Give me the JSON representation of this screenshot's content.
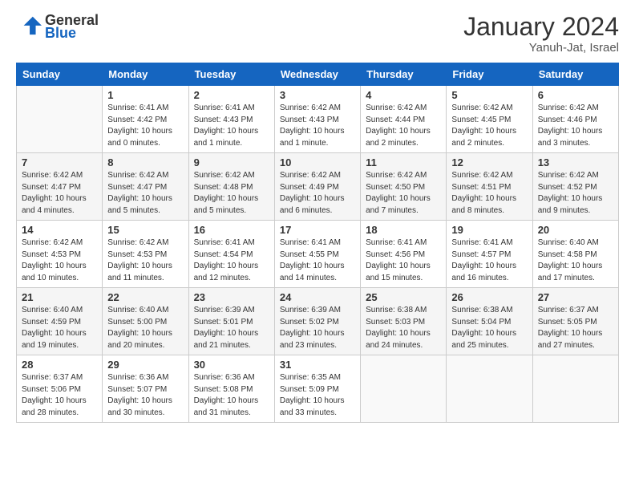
{
  "header": {
    "logo_general": "General",
    "logo_blue": "Blue",
    "month_year": "January 2024",
    "location": "Yanuh-Jat, Israel"
  },
  "calendar": {
    "days_of_week": [
      "Sunday",
      "Monday",
      "Tuesday",
      "Wednesday",
      "Thursday",
      "Friday",
      "Saturday"
    ],
    "weeks": [
      [
        {
          "day": "",
          "sunrise": "",
          "sunset": "",
          "daylight": ""
        },
        {
          "day": "1",
          "sunrise": "Sunrise: 6:41 AM",
          "sunset": "Sunset: 4:42 PM",
          "daylight": "Daylight: 10 hours and 0 minutes."
        },
        {
          "day": "2",
          "sunrise": "Sunrise: 6:41 AM",
          "sunset": "Sunset: 4:43 PM",
          "daylight": "Daylight: 10 hours and 1 minute."
        },
        {
          "day": "3",
          "sunrise": "Sunrise: 6:42 AM",
          "sunset": "Sunset: 4:43 PM",
          "daylight": "Daylight: 10 hours and 1 minute."
        },
        {
          "day": "4",
          "sunrise": "Sunrise: 6:42 AM",
          "sunset": "Sunset: 4:44 PM",
          "daylight": "Daylight: 10 hours and 2 minutes."
        },
        {
          "day": "5",
          "sunrise": "Sunrise: 6:42 AM",
          "sunset": "Sunset: 4:45 PM",
          "daylight": "Daylight: 10 hours and 2 minutes."
        },
        {
          "day": "6",
          "sunrise": "Sunrise: 6:42 AM",
          "sunset": "Sunset: 4:46 PM",
          "daylight": "Daylight: 10 hours and 3 minutes."
        }
      ],
      [
        {
          "day": "7",
          "sunrise": "Sunrise: 6:42 AM",
          "sunset": "Sunset: 4:47 PM",
          "daylight": "Daylight: 10 hours and 4 minutes."
        },
        {
          "day": "8",
          "sunrise": "Sunrise: 6:42 AM",
          "sunset": "Sunset: 4:47 PM",
          "daylight": "Daylight: 10 hours and 5 minutes."
        },
        {
          "day": "9",
          "sunrise": "Sunrise: 6:42 AM",
          "sunset": "Sunset: 4:48 PM",
          "daylight": "Daylight: 10 hours and 5 minutes."
        },
        {
          "day": "10",
          "sunrise": "Sunrise: 6:42 AM",
          "sunset": "Sunset: 4:49 PM",
          "daylight": "Daylight: 10 hours and 6 minutes."
        },
        {
          "day": "11",
          "sunrise": "Sunrise: 6:42 AM",
          "sunset": "Sunset: 4:50 PM",
          "daylight": "Daylight: 10 hours and 7 minutes."
        },
        {
          "day": "12",
          "sunrise": "Sunrise: 6:42 AM",
          "sunset": "Sunset: 4:51 PM",
          "daylight": "Daylight: 10 hours and 8 minutes."
        },
        {
          "day": "13",
          "sunrise": "Sunrise: 6:42 AM",
          "sunset": "Sunset: 4:52 PM",
          "daylight": "Daylight: 10 hours and 9 minutes."
        }
      ],
      [
        {
          "day": "14",
          "sunrise": "Sunrise: 6:42 AM",
          "sunset": "Sunset: 4:53 PM",
          "daylight": "Daylight: 10 hours and 10 minutes."
        },
        {
          "day": "15",
          "sunrise": "Sunrise: 6:42 AM",
          "sunset": "Sunset: 4:53 PM",
          "daylight": "Daylight: 10 hours and 11 minutes."
        },
        {
          "day": "16",
          "sunrise": "Sunrise: 6:41 AM",
          "sunset": "Sunset: 4:54 PM",
          "daylight": "Daylight: 10 hours and 12 minutes."
        },
        {
          "day": "17",
          "sunrise": "Sunrise: 6:41 AM",
          "sunset": "Sunset: 4:55 PM",
          "daylight": "Daylight: 10 hours and 14 minutes."
        },
        {
          "day": "18",
          "sunrise": "Sunrise: 6:41 AM",
          "sunset": "Sunset: 4:56 PM",
          "daylight": "Daylight: 10 hours and 15 minutes."
        },
        {
          "day": "19",
          "sunrise": "Sunrise: 6:41 AM",
          "sunset": "Sunset: 4:57 PM",
          "daylight": "Daylight: 10 hours and 16 minutes."
        },
        {
          "day": "20",
          "sunrise": "Sunrise: 6:40 AM",
          "sunset": "Sunset: 4:58 PM",
          "daylight": "Daylight: 10 hours and 17 minutes."
        }
      ],
      [
        {
          "day": "21",
          "sunrise": "Sunrise: 6:40 AM",
          "sunset": "Sunset: 4:59 PM",
          "daylight": "Daylight: 10 hours and 19 minutes."
        },
        {
          "day": "22",
          "sunrise": "Sunrise: 6:40 AM",
          "sunset": "Sunset: 5:00 PM",
          "daylight": "Daylight: 10 hours and 20 minutes."
        },
        {
          "day": "23",
          "sunrise": "Sunrise: 6:39 AM",
          "sunset": "Sunset: 5:01 PM",
          "daylight": "Daylight: 10 hours and 21 minutes."
        },
        {
          "day": "24",
          "sunrise": "Sunrise: 6:39 AM",
          "sunset": "Sunset: 5:02 PM",
          "daylight": "Daylight: 10 hours and 23 minutes."
        },
        {
          "day": "25",
          "sunrise": "Sunrise: 6:38 AM",
          "sunset": "Sunset: 5:03 PM",
          "daylight": "Daylight: 10 hours and 24 minutes."
        },
        {
          "day": "26",
          "sunrise": "Sunrise: 6:38 AM",
          "sunset": "Sunset: 5:04 PM",
          "daylight": "Daylight: 10 hours and 25 minutes."
        },
        {
          "day": "27",
          "sunrise": "Sunrise: 6:37 AM",
          "sunset": "Sunset: 5:05 PM",
          "daylight": "Daylight: 10 hours and 27 minutes."
        }
      ],
      [
        {
          "day": "28",
          "sunrise": "Sunrise: 6:37 AM",
          "sunset": "Sunset: 5:06 PM",
          "daylight": "Daylight: 10 hours and 28 minutes."
        },
        {
          "day": "29",
          "sunrise": "Sunrise: 6:36 AM",
          "sunset": "Sunset: 5:07 PM",
          "daylight": "Daylight: 10 hours and 30 minutes."
        },
        {
          "day": "30",
          "sunrise": "Sunrise: 6:36 AM",
          "sunset": "Sunset: 5:08 PM",
          "daylight": "Daylight: 10 hours and 31 minutes."
        },
        {
          "day": "31",
          "sunrise": "Sunrise: 6:35 AM",
          "sunset": "Sunset: 5:09 PM",
          "daylight": "Daylight: 10 hours and 33 minutes."
        },
        {
          "day": "",
          "sunrise": "",
          "sunset": "",
          "daylight": ""
        },
        {
          "day": "",
          "sunrise": "",
          "sunset": "",
          "daylight": ""
        },
        {
          "day": "",
          "sunrise": "",
          "sunset": "",
          "daylight": ""
        }
      ]
    ]
  }
}
